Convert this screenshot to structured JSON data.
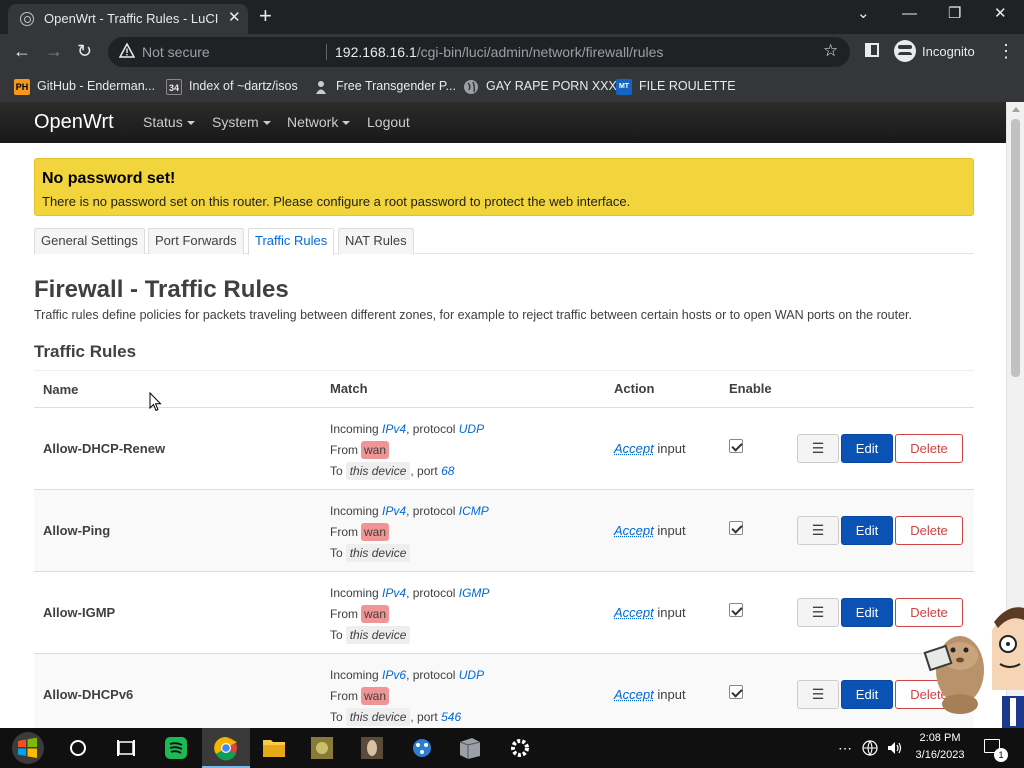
{
  "browser": {
    "tab_title": "OpenWrt - Traffic Rules - LuCI",
    "security_label": "Not secure",
    "url_host": "192.168.16.1",
    "url_path": "/cgi-bin/luci/admin/network/firewall/rules",
    "profile_label": "Incognito",
    "bookmarks": [
      {
        "label": "GitHub - Enderman...",
        "icon": "ph-icon",
        "icon_text": "PH",
        "color": "#f7971e"
      },
      {
        "label": "Index of ~dartz/isos",
        "icon": "numbered-icon",
        "icon_text": "34",
        "color": "#3a3a3a"
      },
      {
        "label": "Free Transgender P...",
        "icon": "bookmark-site-icon",
        "icon_text": "",
        "color": "#cccccc"
      },
      {
        "label": "GAY RAPE PORN XXX",
        "icon": "globe-icon",
        "icon_text": "",
        "color": "#9aa0a6"
      },
      {
        "label": "FILE ROULETTE",
        "icon": "file-roulette-icon",
        "icon_text": "MT",
        "color": "#1565c0"
      }
    ]
  },
  "openwrt": {
    "brand": "OpenWrt",
    "menu": [
      "Status",
      "System",
      "Network",
      "Logout"
    ],
    "alert_title": "No password set!",
    "alert_text": "There is no password set on this router. Please configure a root password to protect the web interface.",
    "tabs": [
      "General Settings",
      "Port Forwards",
      "Traffic Rules",
      "NAT Rules"
    ],
    "active_tab": "Traffic Rules",
    "page_title": "Firewall - Traffic Rules",
    "page_description": "Traffic rules define policies for packets traveling between different zones, for example to reject traffic between certain hosts or to open WAN ports on the router.",
    "section_title": "Traffic Rules",
    "columns": [
      "Name",
      "Match",
      "Action",
      "Enable"
    ],
    "buttons": {
      "sort": "☰",
      "edit": "Edit",
      "delete": "Delete"
    },
    "rules": [
      {
        "name": "Allow-DHCP-Renew",
        "family": "IPv4",
        "protocol": "UDP",
        "from_zone": "wan",
        "to": "this device",
        "port": "68",
        "action": "Accept",
        "action_suffix": "input",
        "enabled": true
      },
      {
        "name": "Allow-Ping",
        "family": "IPv4",
        "protocol": "ICMP",
        "from_zone": "wan",
        "to": "this device",
        "port": "",
        "action": "Accept",
        "action_suffix": "input",
        "enabled": true
      },
      {
        "name": "Allow-IGMP",
        "family": "IPv4",
        "protocol": "IGMP",
        "from_zone": "wan",
        "to": "this device",
        "port": "",
        "action": "Accept",
        "action_suffix": "input",
        "enabled": true
      },
      {
        "name": "Allow-DHCPv6",
        "family": "IPv6",
        "protocol": "UDP",
        "from_zone": "wan",
        "to": "this device",
        "port": "546",
        "action": "Accept",
        "action_suffix": "input",
        "enabled": true
      }
    ],
    "match_words": {
      "incoming": "Incoming",
      "protocol": ", protocol",
      "from": "From",
      "to": "To",
      "port": ", port"
    }
  },
  "taskbar": {
    "time": "2:08 PM",
    "date": "3/16/2023",
    "notification_count": "1"
  }
}
